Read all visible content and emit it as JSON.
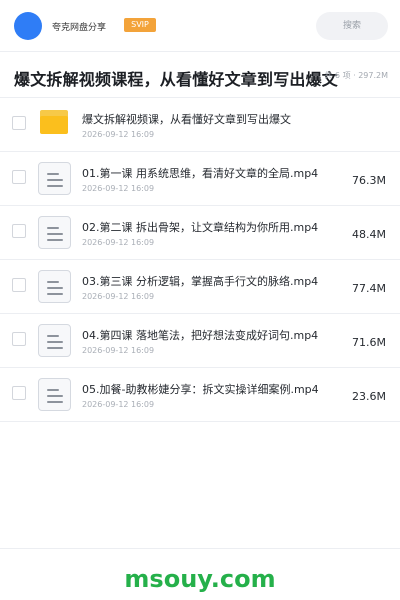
{
  "header": {
    "app_name": "夸克网盘分享",
    "badge": "SVIP",
    "search_placeholder": "搜索"
  },
  "folder": {
    "title": "爆文拆解视频课程，从看懂好文章到写出爆文",
    "summary": "共 6 项 · 297.2M"
  },
  "items": [
    {
      "type": "folder",
      "name": "爆文拆解视频课，从看懂好文章到写出爆文",
      "date": "2026-09-12 16:09",
      "size": ""
    },
    {
      "type": "file",
      "name": "01.第一课 用系统思维，看清好文章的全局.mp4",
      "date": "2026-09-12 16:09",
      "size": "76.3M"
    },
    {
      "type": "file",
      "name": "02.第二课 拆出骨架，让文章结构为你所用.mp4",
      "date": "2026-09-12 16:09",
      "size": "48.4M"
    },
    {
      "type": "file",
      "name": "03.第三课 分析逻辑，掌握高手行文的脉络.mp4",
      "date": "2026-09-12 16:09",
      "size": "77.4M"
    },
    {
      "type": "file",
      "name": "04.第四课 落地笔法，把好想法变成好词句.mp4",
      "date": "2026-09-12 16:09",
      "size": "71.6M"
    },
    {
      "type": "file",
      "name": "05.加餐-助教彬婕分享：拆文实操详细案例.mp4",
      "date": "2026-09-12 16:09",
      "size": "23.6M"
    }
  ],
  "footer": {
    "watermark": "msouy.com"
  },
  "colors": {
    "accent": "#2f7df6",
    "badge": "#f3a33a",
    "folder": "#fbbf1d",
    "watermark": "#25b04a"
  },
  "icons": {
    "file": "video-file-icon",
    "folder": "folder-icon"
  }
}
